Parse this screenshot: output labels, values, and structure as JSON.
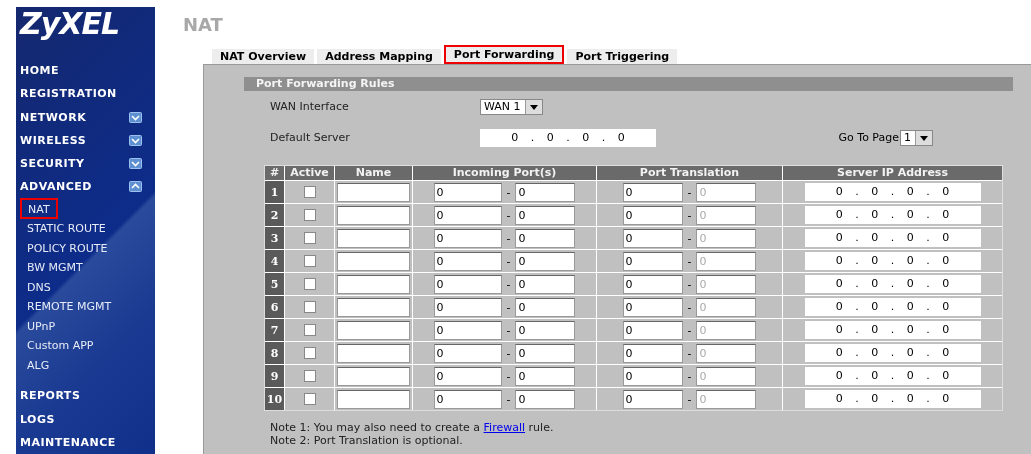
{
  "sidebar": {
    "logo": "ZyXEL",
    "items": [
      {
        "label": "HOME",
        "selected": false
      },
      {
        "label": "REGISTRATION",
        "selected": false
      },
      {
        "label": "NETWORK",
        "expanded": false,
        "selected": false
      },
      {
        "label": "WIRELESS",
        "expanded": false,
        "selected": false
      },
      {
        "label": "SECURITY",
        "expanded": false,
        "selected": false
      },
      {
        "label": "ADVANCED",
        "expanded": true,
        "selected": false,
        "children": [
          {
            "label": "NAT",
            "selected": true
          },
          {
            "label": "STATIC ROUTE",
            "selected": false
          },
          {
            "label": "POLICY ROUTE",
            "selected": false
          },
          {
            "label": "BW MGMT",
            "selected": false
          },
          {
            "label": "DNS",
            "selected": false
          },
          {
            "label": "REMOTE MGMT",
            "selected": false
          },
          {
            "label": "UPnP",
            "selected": false
          },
          {
            "label": "Custom APP",
            "selected": false
          },
          {
            "label": "ALG",
            "selected": false
          }
        ]
      },
      {
        "label": "REPORTS",
        "selected": false
      },
      {
        "label": "LOGS",
        "selected": false
      },
      {
        "label": "MAINTENANCE",
        "selected": false
      }
    ]
  },
  "page_title": "NAT",
  "tabs": [
    {
      "label": "NAT Overview",
      "selected": false
    },
    {
      "label": "Address Mapping",
      "selected": false
    },
    {
      "label": "Port Forwarding",
      "selected": true
    },
    {
      "label": "Port Triggering",
      "selected": false
    }
  ],
  "section_title": "Port Forwarding Rules",
  "wan_interface": {
    "label": "WAN Interface",
    "value": "WAN 1"
  },
  "default_server": {
    "label": "Default Server",
    "value": "0 . 0 . 0 . 0"
  },
  "go_to_page": {
    "label": "Go To Page",
    "value": "1"
  },
  "table": {
    "columns": [
      "#",
      "Active",
      "Name",
      "Incoming Port(s)",
      "Port Translation",
      "Server IP Address"
    ],
    "rows": [
      {
        "number": "1",
        "active": false,
        "incoming": {
          "start": "0",
          "separator": "-",
          "end": "0"
        },
        "translation": {
          "start": "0",
          "separator": "-",
          "end": "0",
          "end_disabled": true
        },
        "server_ip": "0 . 0 . 0 . 0"
      },
      {
        "number": "2",
        "active": false,
        "incoming": {
          "start": "0",
          "separator": "-",
          "end": "0"
        },
        "translation": {
          "start": "0",
          "separator": "-",
          "end": "0",
          "end_disabled": true
        },
        "server_ip": "0 . 0 . 0 . 0"
      },
      {
        "number": "3",
        "active": false,
        "incoming": {
          "start": "0",
          "separator": "-",
          "end": "0"
        },
        "translation": {
          "start": "0",
          "separator": "-",
          "end": "0",
          "end_disabled": true
        },
        "server_ip": "0 . 0 . 0 . 0"
      },
      {
        "number": "4",
        "active": false,
        "incoming": {
          "start": "0",
          "separator": "-",
          "end": "0"
        },
        "translation": {
          "start": "0",
          "separator": "-",
          "end": "0",
          "end_disabled": true
        },
        "server_ip": "0 . 0 . 0 . 0"
      },
      {
        "number": "5",
        "active": false,
        "incoming": {
          "start": "0",
          "separator": "-",
          "end": "0"
        },
        "translation": {
          "start": "0",
          "separator": "-",
          "end": "0",
          "end_disabled": true
        },
        "server_ip": "0 . 0 . 0 . 0"
      },
      {
        "number": "6",
        "active": false,
        "incoming": {
          "start": "0",
          "separator": "-",
          "end": "0"
        },
        "translation": {
          "start": "0",
          "separator": "-",
          "end": "0",
          "end_disabled": true
        },
        "server_ip": "0 . 0 . 0 . 0"
      },
      {
        "number": "7",
        "active": false,
        "incoming": {
          "start": "0",
          "separator": "-",
          "end": "0"
        },
        "translation": {
          "start": "0",
          "separator": "-",
          "end": "0",
          "end_disabled": true
        },
        "server_ip": "0 . 0 . 0 . 0"
      },
      {
        "number": "8",
        "active": false,
        "incoming": {
          "start": "0",
          "separator": "-",
          "end": "0"
        },
        "translation": {
          "start": "0",
          "separator": "-",
          "end": "0",
          "end_disabled": true
        },
        "server_ip": "0 . 0 . 0 . 0"
      },
      {
        "number": "9",
        "active": false,
        "incoming": {
          "start": "0",
          "separator": "-",
          "end": "0"
        },
        "translation": {
          "start": "0",
          "separator": "-",
          "end": "0",
          "end_disabled": true
        },
        "server_ip": "0 . 0 . 0 . 0"
      },
      {
        "number": "10",
        "active": false,
        "incoming": {
          "start": "0",
          "separator": "-",
          "end": "0"
        },
        "translation": {
          "start": "0",
          "separator": "-",
          "end": "0",
          "end_disabled": true
        },
        "server_ip": "0 . 0 . 0 . 0"
      }
    ]
  },
  "notes": [
    {
      "before": "Note 1: You may also need to create a ",
      "link": "Firewall",
      "after": " rule."
    },
    {
      "before": "Note 2: Port Translation is optional."
    }
  ]
}
